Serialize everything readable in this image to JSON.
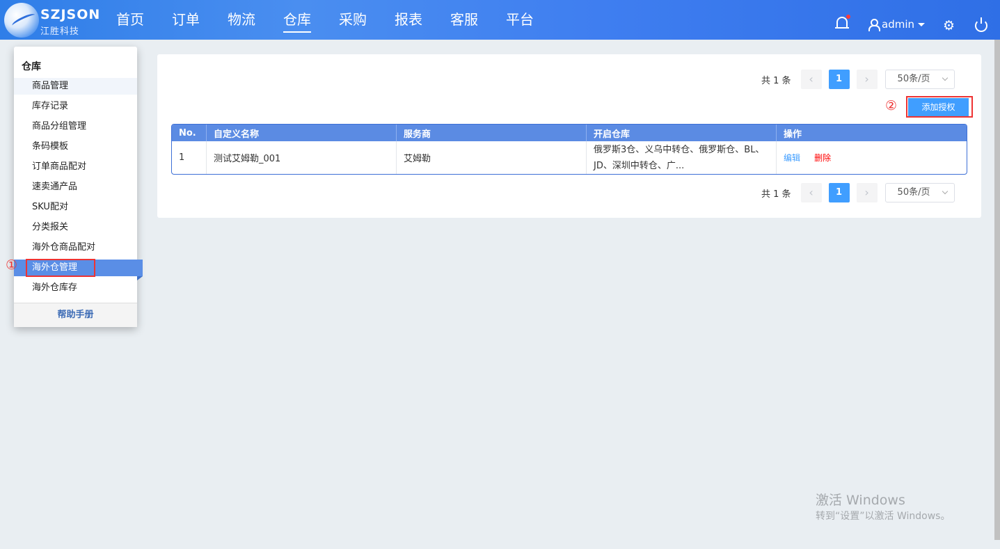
{
  "brand": {
    "name": "SZJSON",
    "sub": "江胜科技"
  },
  "nav": [
    "首页",
    "订单",
    "物流",
    "仓库",
    "采购",
    "报表",
    "客服",
    "平台"
  ],
  "user": {
    "name": "admin"
  },
  "sidebar": {
    "title": "仓库",
    "items": [
      "商品管理",
      "库存记录",
      "商品分组管理",
      "条码模板",
      "订单商品配对",
      "速卖通产品",
      "SKU配对",
      "分类报关",
      "海外仓商品配对",
      "海外仓管理",
      "海外仓库存"
    ],
    "help": "帮助手册",
    "marker": "①"
  },
  "pager": {
    "total": "共 1 条",
    "page": "1",
    "size": "50条/页",
    "prev": "‹",
    "next": "›"
  },
  "actions": {
    "add": "添加授权",
    "marker": "②"
  },
  "table": {
    "headers": [
      "No.",
      "自定义名称",
      "服务商",
      "开启仓库",
      "操作"
    ],
    "rows": [
      {
        "no": "1",
        "name": "测试艾姆勒_001",
        "provider": "艾姆勒",
        "warehouses": "俄罗斯3仓、义乌中转仓、俄罗斯仓、BL、JD、深圳中转仓、广...",
        "edit": "编辑",
        "delete": "删除"
      }
    ]
  },
  "watermark": {
    "line1": "激活 Windows",
    "line2": "转到“设置”以激活 Windows。"
  },
  "icons": {
    "bell": "bell-icon",
    "user": "user-icon",
    "settings": "gear-icon",
    "power": "power-icon"
  }
}
